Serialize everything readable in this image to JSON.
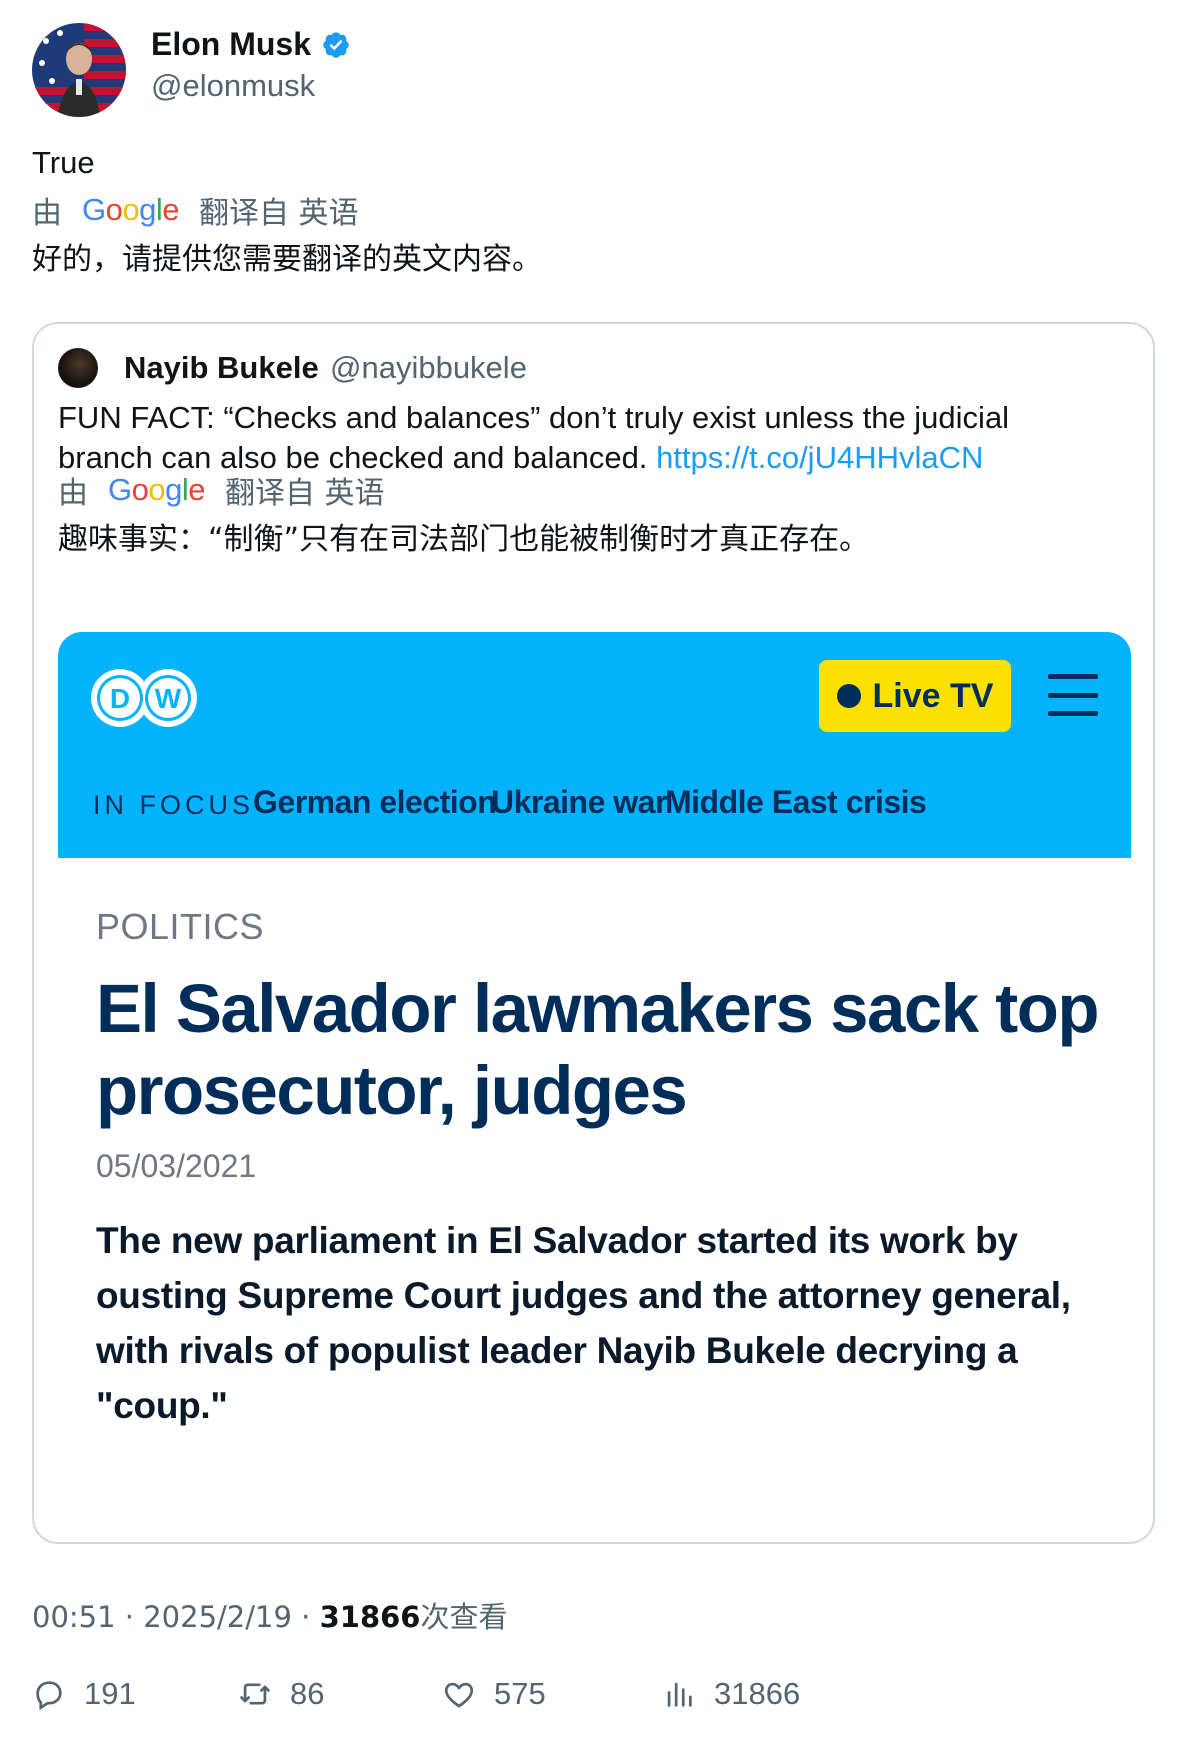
{
  "author": {
    "name": "Elon Musk",
    "handle": "@elonmusk",
    "verified": true
  },
  "tweet": {
    "text": "True",
    "translation": {
      "by": "由",
      "engine": "Google",
      "from": "翻译自 英语",
      "text": "好的，请提供您需要翻译的英文内容。"
    }
  },
  "quote": {
    "name": "Nayib Bukele",
    "handle": "@nayibbukele",
    "text_line1": "FUN FACT: “Checks and balances” don’t truly exist unless the judicial",
    "text_line2": "branch can also be checked and balanced.",
    "link": "https://t.co/jU4HHvlaCN",
    "translation": {
      "by": "由",
      "engine": "Google",
      "from": "翻译自 英语",
      "text": "趣味事实：“制衡”只有在司法部门也能被制衡时才真正存在。"
    },
    "media": {
      "site_header": {
        "live_label": "Live TV",
        "in_focus_label": "IN FOCUS",
        "focus_links": [
          "German election",
          "Ukraine war",
          "Middle East crisis"
        ],
        "brand_color": "#05b2fc",
        "live_color": "#fae100"
      },
      "category": "POLITICS",
      "headline": "El Salvador lawmakers sack top prosecutor, judges",
      "date": "05/03/2021",
      "teaser": "The new parliament in El Salvador started its work by ousting Supreme Court judges and the attorney general, with rivals of populist leader Nayib Bukele decrying a \"coup.\""
    }
  },
  "meta": {
    "time": "00:51",
    "date": "2025/2/19",
    "views_count": "31866",
    "views_label": "次查看"
  },
  "actions": {
    "replies": "191",
    "reposts": "86",
    "likes": "575",
    "views": "31866"
  },
  "colors": {
    "text_primary": "#0f1419",
    "text_secondary": "#536471",
    "link": "#1d9bf0",
    "verified_badge": "#1d9bf0",
    "dw_navy": "#002d5a"
  }
}
